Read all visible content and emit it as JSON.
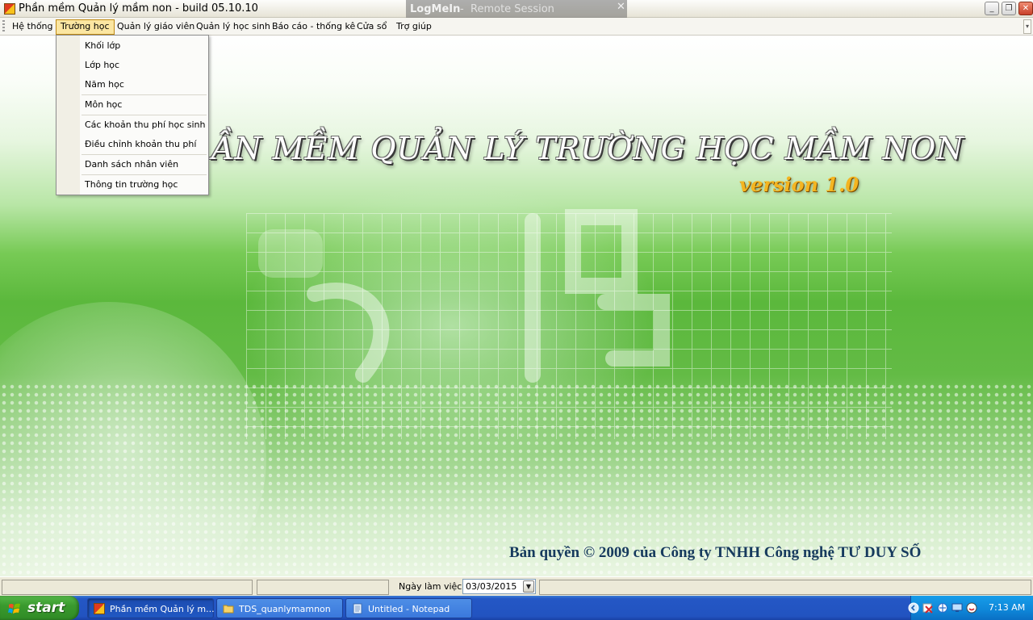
{
  "window": {
    "title": "Phần mềm Quản lý mầm non - build 05.10.10",
    "minimize_glyph": "_",
    "restore_glyph": "❐",
    "close_glyph": "✕"
  },
  "logmein": {
    "brand": "LogMeIn",
    "separator": "-",
    "session": "Remote Session",
    "close_glyph": "✕"
  },
  "menu": {
    "items": [
      {
        "label": "Hệ thống"
      },
      {
        "label": "Trường học",
        "active": true
      },
      {
        "label": "Quản lý giáo viên"
      },
      {
        "label": "Quản lý học sinh"
      },
      {
        "label": "Báo cáo - thống kê"
      },
      {
        "label": "Cửa sổ"
      },
      {
        "label": "Trợ giúp"
      }
    ],
    "overflow_glyph": "▾"
  },
  "dropdown": {
    "items": [
      {
        "label": "Khối lớp"
      },
      {
        "label": "Lớp học"
      },
      {
        "label": "Năm học"
      },
      {
        "label": "Môn học"
      },
      {
        "label": "Các khoản thu phí học sinh"
      },
      {
        "label": "Điều chỉnh khoản thu phí"
      },
      {
        "label": "Danh sách nhân viên"
      },
      {
        "label": "Thông tin trường học"
      }
    ]
  },
  "main": {
    "banner_title": "ẦN MỀM QUẢN LÝ TRƯỜNG HỌC MẦM NON",
    "version": "version 1.0",
    "copyright": "Bản quyền © 2009 của Công ty TNHH Công nghệ TƯ DUY SỐ"
  },
  "status": {
    "work_date_label": "Ngày làm việc:",
    "work_date_value": "03/03/2015",
    "date_dropdown_glyph": "▼"
  },
  "taskbar": {
    "start_label": "start",
    "tasks": [
      {
        "label": "Phần mềm Quản lý m...",
        "icon": "app-icon",
        "active": true
      },
      {
        "label": "TDS_quanlymamnon",
        "icon": "folder-icon"
      },
      {
        "label": "Untitled - Notepad",
        "icon": "notepad-icon"
      }
    ],
    "clock": "7:13 AM"
  },
  "colors": {
    "menu_highlight": "#fbe6a1",
    "taskbar_blue": "#2253c0",
    "start_green": "#3a9a2e",
    "version_gold": "#f4b521",
    "copyright_navy": "#163a5d"
  }
}
